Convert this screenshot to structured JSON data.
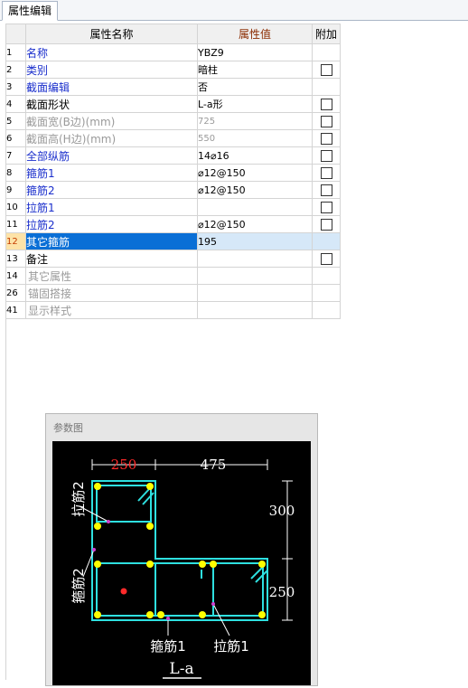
{
  "tab": {
    "label": "属性编辑"
  },
  "grid": {
    "headers": {
      "num": "",
      "name": "属性名称",
      "value": "属性值",
      "extra": "附加"
    },
    "rows": [
      {
        "num": "1",
        "name": "名称",
        "value": "YBZ9",
        "style": "blue",
        "check": false
      },
      {
        "num": "2",
        "name": "类别",
        "value": "暗柱",
        "style": "blue",
        "check": true
      },
      {
        "num": "3",
        "name": "截面编辑",
        "value": "否",
        "style": "blue",
        "check": false
      },
      {
        "num": "4",
        "name": "截面形状",
        "value": "L-a形",
        "style": "black",
        "check": true
      },
      {
        "num": "5",
        "name": "截面宽(B边)(mm)",
        "value": "725",
        "style": "gray",
        "check": true
      },
      {
        "num": "6",
        "name": "截面高(H边)(mm)",
        "value": "550",
        "style": "gray",
        "check": true
      },
      {
        "num": "7",
        "name": "全部纵筋",
        "value": "14⌀16",
        "style": "blue",
        "check": true
      },
      {
        "num": "8",
        "name": "箍筋1",
        "value": "⌀12@150",
        "style": "blue",
        "check": true
      },
      {
        "num": "9",
        "name": "箍筋2",
        "value": "⌀12@150",
        "style": "blue",
        "check": true
      },
      {
        "num": "10",
        "name": "拉筋1",
        "value": "",
        "style": "blue",
        "check": true
      },
      {
        "num": "11",
        "name": "拉筋2",
        "value": "⌀12@150",
        "style": "blue",
        "check": true
      },
      {
        "num": "12",
        "name": "其它箍筋",
        "value": "195",
        "style": "selected",
        "check": false
      },
      {
        "num": "13",
        "name": "备注",
        "value": "",
        "style": "black",
        "check": true
      },
      {
        "num": "14",
        "name": "其它属性",
        "value": "",
        "style": "group",
        "check": false
      },
      {
        "num": "26",
        "name": "锚固搭接",
        "value": "",
        "style": "group",
        "check": false
      },
      {
        "num": "41",
        "name": "显示样式",
        "value": "",
        "style": "group",
        "check": false
      }
    ]
  },
  "param": {
    "title": "参数图",
    "dim_top_left": "250",
    "dim_top_right": "475",
    "dim_right_top": "300",
    "dim_right_bottom": "250",
    "label_left_top": "拉筋2",
    "label_left_bottom": "箍筋2",
    "label_bottom_1": "箍筋1",
    "label_bottom_2": "拉筋1",
    "caption": "L-a",
    "colors": {
      "outline": "#2ee0e0",
      "bar": "#ffff00",
      "dim": "#ffffff",
      "highlight": "#ff2a2a",
      "tie": "#d040d0"
    }
  }
}
